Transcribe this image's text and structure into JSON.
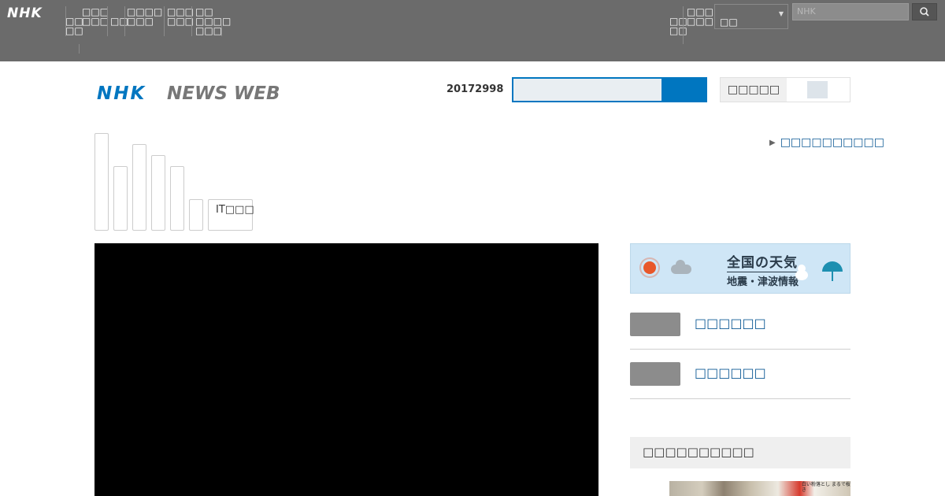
{
  "global_bar": {
    "logo": "NHK",
    "nav_items": [
      "□□\n□□",
      "□□□\n□□□",
      "□□",
      "□□□□\n□□□",
      "□□□\n□□□",
      "□□\n□□□□\n□□□"
    ],
    "right_nav_items": [
      "□□\n□□",
      "□□□\n□□□"
    ],
    "select_value": "□□",
    "search_placeholder": "NHK",
    "search_button_icon": "search-icon"
  },
  "header": {
    "logo_text": "NHK NEWS WEB",
    "date": "20172998",
    "toggle_label": "□□□□□"
  },
  "genre_tabs": {
    "last_label": "IT□□□"
  },
  "side_link": "□□□□□□□□□□",
  "weather": {
    "title": "全国の天気",
    "subtitle": "地震・津波情報"
  },
  "right_list": [
    {
      "label": "□□□□□□"
    },
    {
      "label": "□□□□□□"
    }
  ],
  "ranking": {
    "heading": "□□□□□□□□□□",
    "thumb_text": "白い粉落とし まるで桜き"
  },
  "colors": {
    "accent": "#0076c0",
    "global_bar": "#6b6b6b",
    "link": "#0b5894"
  }
}
